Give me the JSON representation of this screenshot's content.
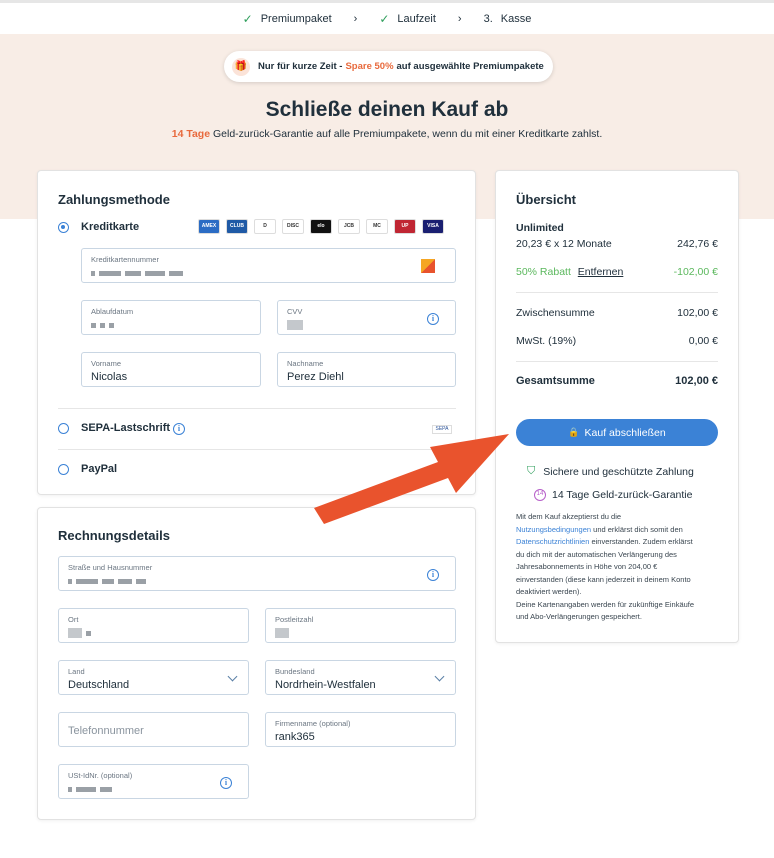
{
  "steps": [
    {
      "label": "Premiumpaket"
    },
    {
      "label": "Laufzeit"
    },
    {
      "number": "3.",
      "label": "Kasse"
    }
  ],
  "promo": {
    "prefix": "Nur für kurze Zeit -",
    "highlight": "Spare 50%",
    "suffix": "auf ausgewählte Premiumpakete"
  },
  "page_title": "Schließe deinen Kauf ab",
  "subtitle": {
    "highlight": "14 Tage",
    "text": "Geld-zurück-Garantie auf alle Premiumpakete, wenn du mit einer Kreditkarte zahlst."
  },
  "payment": {
    "title": "Zahlungsmethode",
    "methods": [
      {
        "label": "Kreditkarte",
        "selected": true
      },
      {
        "label": "SEPA-Lastschrift",
        "selected": false
      },
      {
        "label": "PayPal",
        "selected": false
      }
    ],
    "card_icons": [
      {
        "name": "amex-icon",
        "color": "#2b6cc4",
        "text": "AMEX"
      },
      {
        "name": "diners-icon",
        "color": "#1f5aa6",
        "text": "CLUB"
      },
      {
        "name": "diners-alt-icon",
        "color": "#ffffff",
        "text": "D"
      },
      {
        "name": "discover-icon",
        "color": "#ffffff",
        "text": "DISC"
      },
      {
        "name": "elo-icon",
        "color": "#111111",
        "text": "elo"
      },
      {
        "name": "jcb-icon",
        "color": "#ffffff",
        "text": "JCB"
      },
      {
        "name": "mastercard-icon",
        "color": "#ffffff",
        "text": "MC"
      },
      {
        "name": "unionpay-icon",
        "color": "#c02633",
        "text": "UP"
      },
      {
        "name": "visa-icon",
        "color": "#1a1f71",
        "text": "VISA"
      }
    ],
    "fields": {
      "card_number_label": "Kreditkartennummer",
      "expiry_label": "Ablaufdatum",
      "cvv_label": "CVV",
      "first_name_label": "Vorname",
      "first_name_value": "Nicolas",
      "last_name_label": "Nachname",
      "last_name_value": "Perez Diehl"
    }
  },
  "billing": {
    "title": "Rechnungsdetails",
    "street_label": "Straße und Hausnummer",
    "city_label": "Ort",
    "zip_label": "Postleitzahl",
    "country_label": "Land",
    "country_value": "Deutschland",
    "state_label": "Bundesland",
    "state_value": "Nordrhein-Westfalen",
    "phone_placeholder": "Telefonnummer",
    "company_label": "Firmenname (optional)",
    "company_value": "rank365",
    "vat_label": "USt-IdNr. (optional)"
  },
  "overview": {
    "title": "Übersicht",
    "plan_name": "Unlimited",
    "plan_price_label": "20,23 € x 12 Monate",
    "plan_price": "242,76 €",
    "discount_label": "50% Rabatt",
    "discount_remove": "Entfernen",
    "discount_value": "-102,00 €",
    "subtotal_label": "Zwischensumme",
    "subtotal_value": "102,00 €",
    "tax_label": "MwSt. (19%)",
    "tax_value": "0,00 €",
    "total_label": "Gesamtsumme",
    "total_value": "102,00 €",
    "buy_button": "Kauf abschließen",
    "secure_text": "Sichere und geschützte Zahlung",
    "guarantee_text": "14 Tage Geld-zurück-Garantie",
    "legal": {
      "p1_a": "Mit dem Kauf akzeptierst du die",
      "terms_link": "Nutzungsbedingungen",
      "p1_b": "und erklärst dich somit den",
      "privacy_link": "Datenschutzrichtlinien",
      "p1_c": "einverstanden. Zudem erklärst",
      "p1_d": "du dich mit der automatischen Verlängerung des",
      "p1_e": "Jahresabonnements in Höhe von 204,00 €",
      "p1_f": "einverstanden (diese kann jederzeit in deinem Konto",
      "p1_g": "deaktiviert werden).",
      "p2_a": "Deine Kartenangaben werden für zukünftige Einkäufe",
      "p2_b": "und Abo-Verlängerungen gespeichert."
    }
  },
  "colors": {
    "accent": "#3b82d6",
    "promo": "#e8693c",
    "discount": "#5bb85d",
    "arrow": "#e9532d",
    "hero_bg": "#f8ede6"
  }
}
